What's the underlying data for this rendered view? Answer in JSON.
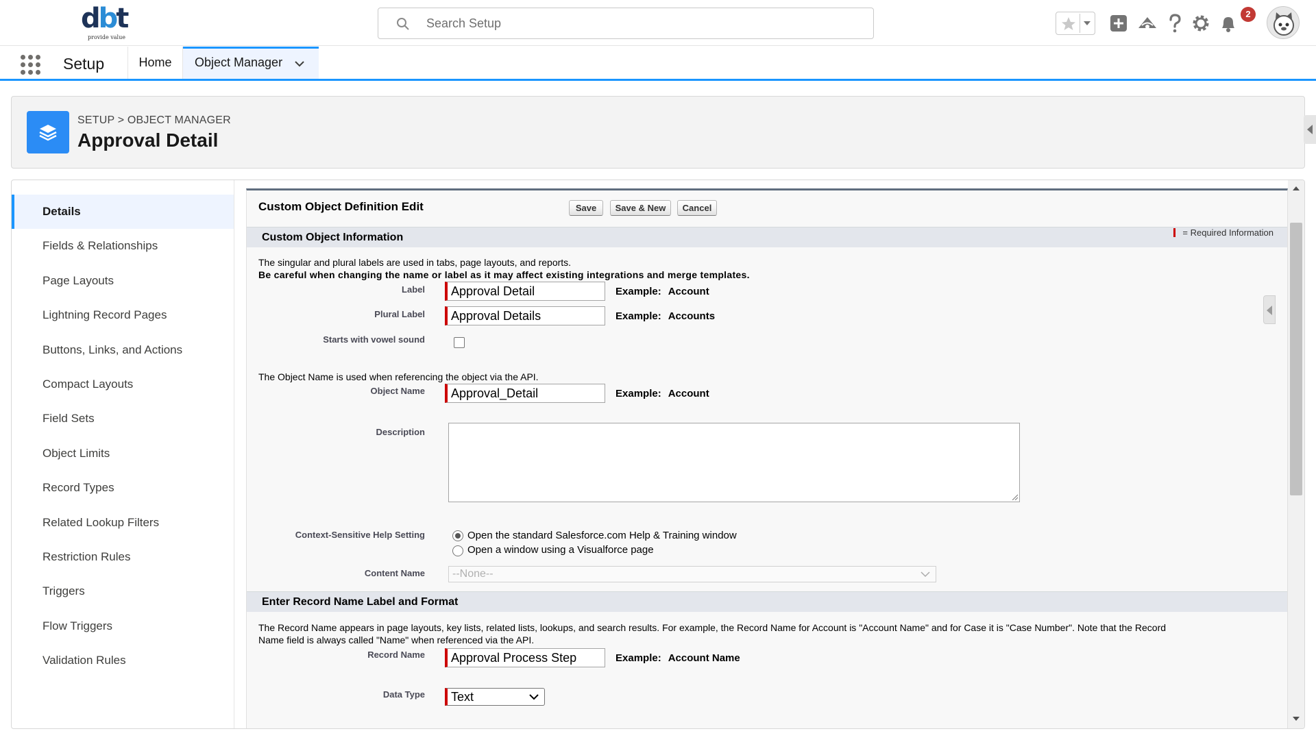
{
  "brand": {
    "logo_text": "dbt",
    "tagline": "provide value"
  },
  "header": {
    "search_placeholder": "Search Setup",
    "notification_count": "2"
  },
  "app_nav": {
    "app_name": "Setup",
    "tabs": [
      {
        "label": "Home"
      },
      {
        "label": "Object Manager"
      }
    ]
  },
  "page_header": {
    "breadcrumb": "SETUP > OBJECT MANAGER",
    "title": "Approval Detail"
  },
  "sidebar": {
    "items": [
      {
        "label": "Details",
        "active": true
      },
      {
        "label": "Fields & Relationships"
      },
      {
        "label": "Page Layouts"
      },
      {
        "label": "Lightning Record Pages"
      },
      {
        "label": "Buttons, Links, and Actions"
      },
      {
        "label": "Compact Layouts"
      },
      {
        "label": "Field Sets"
      },
      {
        "label": "Object Limits"
      },
      {
        "label": "Record Types"
      },
      {
        "label": "Related Lookup Filters"
      },
      {
        "label": "Restriction Rules"
      },
      {
        "label": "Triggers"
      },
      {
        "label": "Flow Triggers"
      },
      {
        "label": "Validation Rules"
      }
    ]
  },
  "form": {
    "title": "Custom Object Definition Edit",
    "buttons": {
      "save": "Save",
      "save_new": "Save & New",
      "cancel": "Cancel"
    },
    "section1": {
      "title": "Custom Object Information",
      "required_legend": "= Required Information",
      "intro": "The singular and plural labels are used in tabs, page layouts, and reports.",
      "warning": "Be careful when changing the name or label as it may affect existing integrations and merge templates.",
      "label": {
        "label": "Label",
        "value": "Approval Detail",
        "example_prefix": "Example:",
        "example": "Account"
      },
      "plural_label": {
        "label": "Plural Label",
        "value": "Approval Details",
        "example_prefix": "Example:",
        "example": "Accounts"
      },
      "vowel": {
        "label": "Starts with vowel sound",
        "checked": false
      },
      "api_intro": "The Object Name is used when referencing the object via the API.",
      "object_name": {
        "label": "Object Name",
        "value": "Approval_Detail",
        "example_prefix": "Example:",
        "example": "Account"
      },
      "description": {
        "label": "Description",
        "value": ""
      },
      "help_setting": {
        "label": "Context-Sensitive Help Setting",
        "options": [
          {
            "label": "Open the standard Salesforce.com Help & Training window",
            "selected": true
          },
          {
            "label": "Open a window using a Visualforce page",
            "selected": false
          }
        ]
      },
      "content_name": {
        "label": "Content Name",
        "value": "--None--"
      }
    },
    "section2": {
      "title": "Enter Record Name Label and Format",
      "intro_line1": "The Record Name appears in page layouts, key lists, related lists, lookups, and search results. For example, the Record Name for Account is \"Account Name\" and for Case it is \"Case Number\". Note that the Record",
      "intro_line2": "Name field is always called \"Name\" when referenced via the API.",
      "record_name": {
        "label": "Record Name",
        "value": "Approval Process Step",
        "example_prefix": "Example:",
        "example": "Account Name"
      },
      "data_type": {
        "label": "Data Type",
        "value": "Text"
      }
    }
  }
}
